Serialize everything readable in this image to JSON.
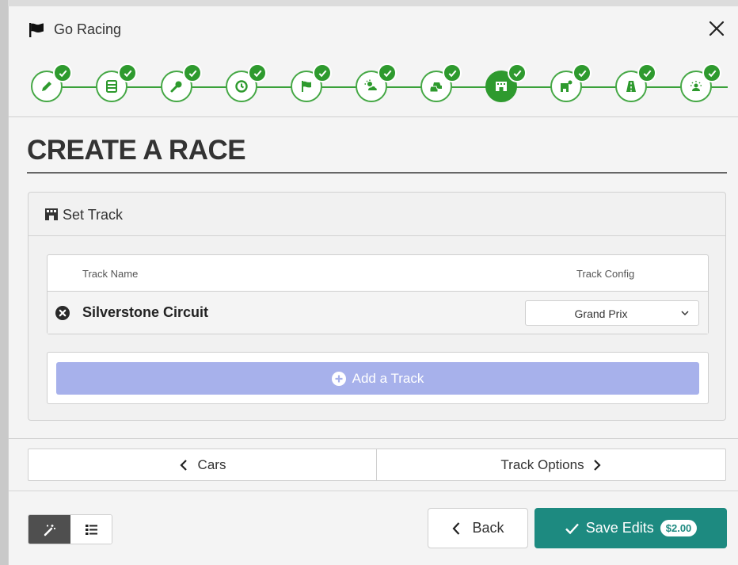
{
  "window": {
    "title": "Go Racing",
    "icon": "flag-icon",
    "close_icon": "close-icon"
  },
  "wizard": {
    "steps": [
      {
        "icon": "pencil-icon",
        "completed": true,
        "active": false
      },
      {
        "icon": "server-list-icon",
        "completed": true,
        "active": false
      },
      {
        "icon": "key-icon",
        "completed": true,
        "active": false
      },
      {
        "icon": "clock-icon",
        "completed": true,
        "active": false
      },
      {
        "icon": "flag-icon",
        "completed": true,
        "active": false
      },
      {
        "icon": "weather-icon",
        "completed": true,
        "active": false
      },
      {
        "icon": "cars-icon",
        "completed": true,
        "active": false
      },
      {
        "icon": "track-icon",
        "completed": true,
        "active": true
      },
      {
        "icon": "track-settings-icon",
        "completed": true,
        "active": false
      },
      {
        "icon": "road-icon",
        "completed": true,
        "active": false
      },
      {
        "icon": "participants-icon",
        "completed": true,
        "active": false
      }
    ],
    "colors": {
      "step_green": "#2e9a2e"
    }
  },
  "page": {
    "title": "CREATE A RACE"
  },
  "panel": {
    "title": "Set Track",
    "icon": "track-icon",
    "table": {
      "headers": {
        "name": "Track Name",
        "config": "Track Config"
      },
      "rows": [
        {
          "name": "Silverstone Circuit",
          "config": "Grand Prix"
        }
      ]
    },
    "add_button": {
      "label": "Add a Track",
      "color": "#a7b1eb"
    }
  },
  "nav": {
    "prev_label": "Cars",
    "next_label": "Track Options"
  },
  "footer": {
    "back_label": "Back",
    "save_label": "Save Edits",
    "save_price": "$2.00",
    "save_color": "#1d8a80"
  }
}
